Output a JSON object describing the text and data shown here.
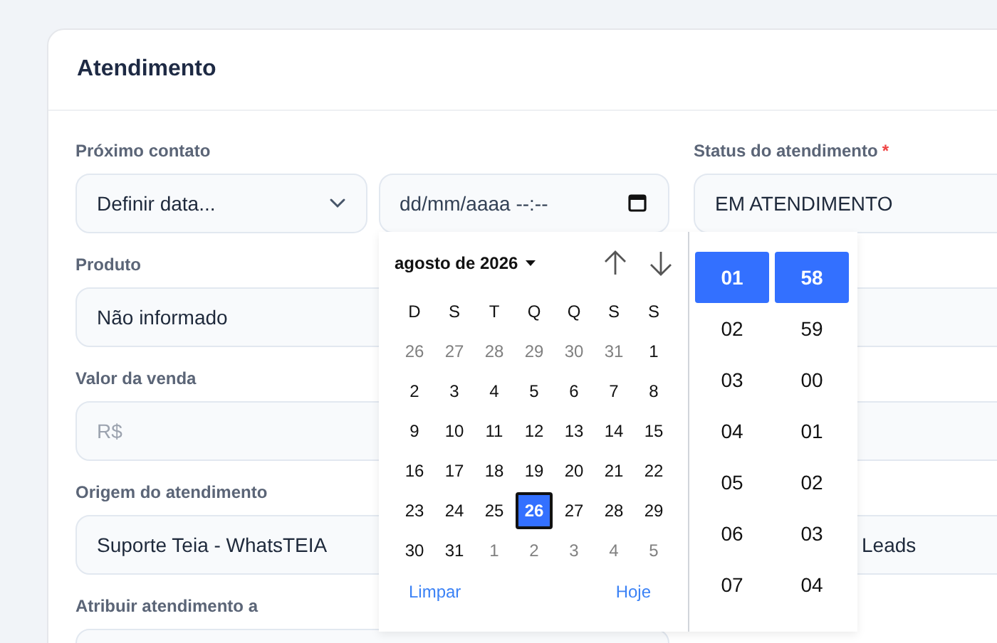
{
  "card": {
    "title": "Atendimento"
  },
  "next_contact": {
    "label": "Próximo contato",
    "select": {
      "value": "Definir data..."
    },
    "datetime": {
      "placeholder": "dd/mm/aaaa --:--"
    }
  },
  "status": {
    "label": "Status do atendimento",
    "required_mark": "*",
    "value": "EM ATENDIMENTO"
  },
  "product": {
    "label": "Produto",
    "value": "Não informado"
  },
  "sale_value": {
    "label": "Valor da venda",
    "placeholder": "R$"
  },
  "origin": {
    "label": "Origem do atendimento",
    "value": "Suporte Teia - WhatsTEIA"
  },
  "origin_right": {
    "value": "Leads"
  },
  "assign": {
    "label": "Atribuir atendimento a"
  },
  "picker": {
    "month_label": "agosto de 2026",
    "weekdays": [
      "D",
      "S",
      "T",
      "Q",
      "Q",
      "S",
      "S"
    ],
    "weeks": [
      [
        {
          "day": "26",
          "muted": true,
          "selected": false
        },
        {
          "day": "27",
          "muted": true,
          "selected": false
        },
        {
          "day": "28",
          "muted": true,
          "selected": false
        },
        {
          "day": "29",
          "muted": true,
          "selected": false
        },
        {
          "day": "30",
          "muted": true,
          "selected": false
        },
        {
          "day": "31",
          "muted": true,
          "selected": false
        },
        {
          "day": "1",
          "muted": false,
          "selected": false
        }
      ],
      [
        {
          "day": "2",
          "muted": false,
          "selected": false
        },
        {
          "day": "3",
          "muted": false,
          "selected": false
        },
        {
          "day": "4",
          "muted": false,
          "selected": false
        },
        {
          "day": "5",
          "muted": false,
          "selected": false
        },
        {
          "day": "6",
          "muted": false,
          "selected": false
        },
        {
          "day": "7",
          "muted": false,
          "selected": false
        },
        {
          "day": "8",
          "muted": false,
          "selected": false
        }
      ],
      [
        {
          "day": "9",
          "muted": false,
          "selected": false
        },
        {
          "day": "10",
          "muted": false,
          "selected": false
        },
        {
          "day": "11",
          "muted": false,
          "selected": false
        },
        {
          "day": "12",
          "muted": false,
          "selected": false
        },
        {
          "day": "13",
          "muted": false,
          "selected": false
        },
        {
          "day": "14",
          "muted": false,
          "selected": false
        },
        {
          "day": "15",
          "muted": false,
          "selected": false
        }
      ],
      [
        {
          "day": "16",
          "muted": false,
          "selected": false
        },
        {
          "day": "17",
          "muted": false,
          "selected": false
        },
        {
          "day": "18",
          "muted": false,
          "selected": false
        },
        {
          "day": "19",
          "muted": false,
          "selected": false
        },
        {
          "day": "20",
          "muted": false,
          "selected": false
        },
        {
          "day": "21",
          "muted": false,
          "selected": false
        },
        {
          "day": "22",
          "muted": false,
          "selected": false
        }
      ],
      [
        {
          "day": "23",
          "muted": false,
          "selected": false
        },
        {
          "day": "24",
          "muted": false,
          "selected": false
        },
        {
          "day": "25",
          "muted": false,
          "selected": false
        },
        {
          "day": "26",
          "muted": false,
          "selected": true
        },
        {
          "day": "27",
          "muted": false,
          "selected": false
        },
        {
          "day": "28",
          "muted": false,
          "selected": false
        },
        {
          "day": "29",
          "muted": false,
          "selected": false
        }
      ],
      [
        {
          "day": "30",
          "muted": false,
          "selected": false
        },
        {
          "day": "31",
          "muted": false,
          "selected": false
        },
        {
          "day": "1",
          "muted": true,
          "selected": false
        },
        {
          "day": "2",
          "muted": true,
          "selected": false
        },
        {
          "day": "3",
          "muted": true,
          "selected": false
        },
        {
          "day": "4",
          "muted": true,
          "selected": false
        },
        {
          "day": "5",
          "muted": true,
          "selected": false
        }
      ]
    ],
    "clear": "Limpar",
    "today": "Hoje",
    "hours": [
      {
        "value": "01",
        "selected": true
      },
      {
        "value": "02",
        "selected": false
      },
      {
        "value": "03",
        "selected": false
      },
      {
        "value": "04",
        "selected": false
      },
      {
        "value": "05",
        "selected": false
      },
      {
        "value": "06",
        "selected": false
      },
      {
        "value": "07",
        "selected": false
      }
    ],
    "minutes": [
      {
        "value": "58",
        "selected": true
      },
      {
        "value": "59",
        "selected": false
      },
      {
        "value": "00",
        "selected": false
      },
      {
        "value": "01",
        "selected": false
      },
      {
        "value": "02",
        "selected": false
      },
      {
        "value": "03",
        "selected": false
      },
      {
        "value": "04",
        "selected": false
      }
    ]
  }
}
